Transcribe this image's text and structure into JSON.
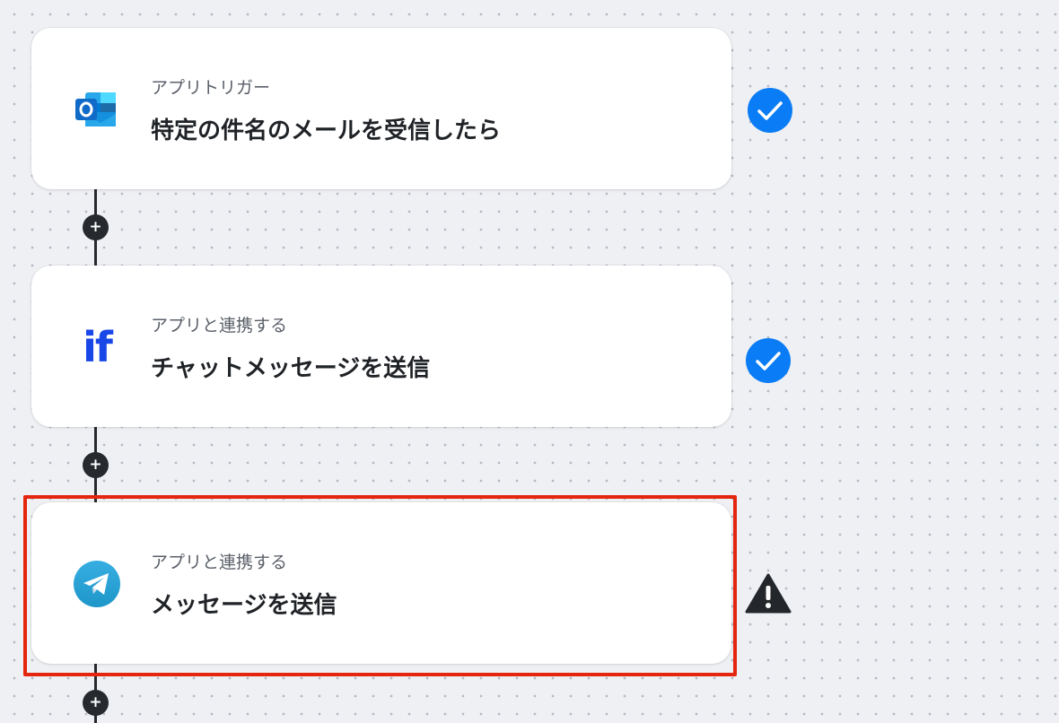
{
  "steps": [
    {
      "subtitle": "アプリトリガー",
      "title": "特定の件名のメールを受信したら",
      "icon": "outlook-icon",
      "status": "complete"
    },
    {
      "subtitle": "アプリと連携する",
      "title": "チャットメッセージを送信",
      "icon": "if-logo-icon",
      "status": "complete"
    },
    {
      "subtitle": "アプリと連携する",
      "title": "メッセージを送信",
      "icon": "telegram-icon",
      "status": "warning"
    }
  ],
  "add_step_label": "+",
  "if_logo_text": "if",
  "colors": {
    "check": "#0a7cf5",
    "warning": "#23262b",
    "highlight_border": "#e5260f",
    "connector": "#26292e",
    "outlook_blue": "#0f6ac8",
    "if_logo": "#1946e6",
    "telegram": "#2aa3dd"
  }
}
